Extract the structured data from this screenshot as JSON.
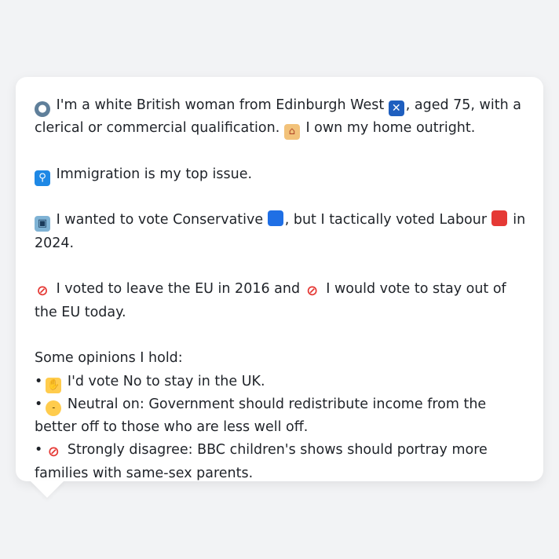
{
  "profile": {
    "intro_a": "I'm a white British woman from Edinburgh West",
    "intro_b": ", aged 75, with a clerical or commercial qualification.",
    "intro_c": "I own my home outright.",
    "top_issue": "Immigration is my top issue.",
    "vote_a": "I wanted to vote Conservative",
    "vote_b": ", but I tactically voted Labour",
    "vote_c": "in 2024.",
    "eu_a": "I voted to leave the EU in 2016 and",
    "eu_b": "I would vote to stay out of the EU today.",
    "opinions_heading": "Some opinions I hold:",
    "opinions": [
      {
        "bullet": "•",
        "text": "I'd vote No to stay in the UK."
      },
      {
        "bullet": "•",
        "text": "Neutral on: Government should redistribute income from the better off to those who are less well off."
      },
      {
        "bullet": "•",
        "text": "Strongly disagree: BBC children's shows should portray more families with same-sex parents."
      }
    ]
  },
  "icons": {
    "person": "bust-in-silhouette-icon",
    "flag": "scotland-flag-icon",
    "house": "house-icon",
    "passport": "passport-control-icon",
    "ballot": "ballot-box-icon",
    "blue_square": "blue-square-icon",
    "red_square": "red-square-icon",
    "no_entry": "prohibited-icon",
    "handshake": "handshake-icon",
    "neutral": "neutral-face-icon"
  },
  "colors": {
    "background": "#f2f3f5",
    "bubble": "#ffffff",
    "text": "#1f2329",
    "conservative": "#1f6fe5",
    "labour": "#e53935"
  }
}
